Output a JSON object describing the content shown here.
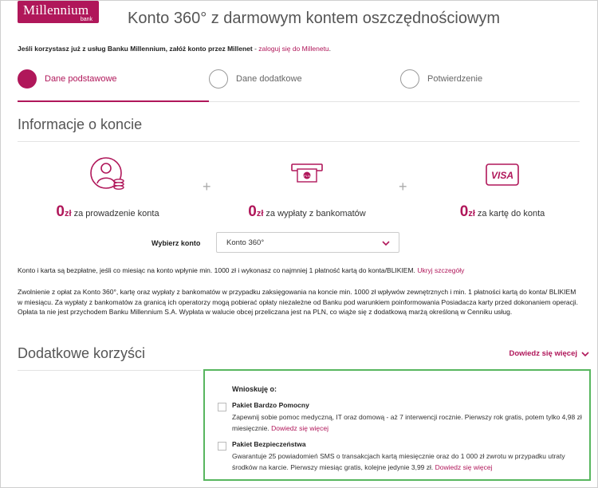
{
  "header": {
    "logo_main": "Millennium",
    "logo_sub": "bank",
    "title": "Konto 360° z darmowym kontem oszczędnościowym"
  },
  "intro": {
    "text": "Jeśli korzystasz już z usług Banku Millennium, załóż konto przez Millenet",
    "sep": " - ",
    "link": "zaloguj się do Millenetu",
    "end": "."
  },
  "steps": [
    {
      "label": "Dane podstawowe",
      "active": true
    },
    {
      "label": "Dane dodatkowe",
      "active": false
    },
    {
      "label": "Potwierdzenie",
      "active": false
    }
  ],
  "account_section": {
    "title": "Informacje o koncie",
    "features": [
      {
        "amount": "0",
        "unit": "zł",
        "text": "za prowadzenie konta",
        "icon": "person-coins-icon"
      },
      {
        "amount": "0",
        "unit": "zł",
        "text": "za wypłaty z bankomatów",
        "icon": "atm-cash-icon"
      },
      {
        "amount": "0",
        "unit": "zł",
        "text": "za kartę do konta",
        "icon": "visa-card-icon"
      }
    ],
    "plus": "+",
    "select_label": "Wybierz konto",
    "select_value": "Konto 360°",
    "note": "Konto i karta są bezpłatne, jeśli co miesiąc na konto wpłynie min. 1000 zł i wykonasz co najmniej 1 płatność kartą do konta/BLIKIEM.",
    "note_link": "Ukryj szczegóły",
    "details": "Zwolnienie z opłat za Konto 360°, kartę oraz wypłaty z bankomatów w przypadku zaksięgowania na koncie min. 1000 zł wpływów zewnętrznych i min. 1 płatności kartą do konta/ BLIKIEM w miesiącu. Za wypłaty z bankomatów za granicą ich operatorzy mogą pobierać opłaty niezależne od Banku pod warunkiem poinformowania Posiadacza karty przed dokonaniem operacji. Opłata ta nie jest przychodem Banku Millennium S.A. Wypłata w walucie obcej przeliczana jest na PLN, co wiąże się z dodatkową marżą określoną w Cenniku usług."
  },
  "benefits_section": {
    "title": "Dodatkowe korzyści",
    "more_link": "Dowiedz się więcej",
    "apply_label": "Wnioskuję o:",
    "options": [
      {
        "title": "Pakiet Bardzo Pomocny",
        "desc": "Zapewnij sobie pomoc medyczną, IT oraz domową - aż 7 interwencji rocznie. Pierwszy rok gratis, potem tylko 4,98 zł miesięcznie.",
        "link": "Dowiedz się więcej"
      },
      {
        "title": "Pakiet Bezpieczeństwa",
        "desc": "Gwarantuje 25 powiadomień SMS o transakcjach kartą miesięcznie oraz do 1 000 zł zwrotu w przypadku utraty środków na karcie. Pierwszy miesiąc gratis, kolejne jedynie 3,99 zł.",
        "link": "Dowiedz się więcej"
      }
    ]
  },
  "colors": {
    "brand": "#b0175a",
    "highlight_border": "#58b65f"
  }
}
